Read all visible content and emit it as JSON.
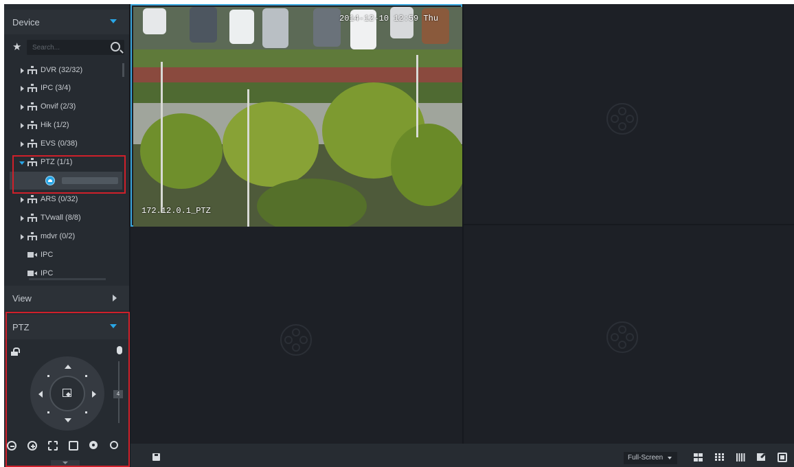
{
  "sidebar": {
    "device_header": {
      "title": "Device"
    },
    "search": {
      "placeholder": "Search..."
    },
    "tree": [
      {
        "label": "DVR (32/32)"
      },
      {
        "label": "IPC (3/4)"
      },
      {
        "label": "Onvif (2/3)"
      },
      {
        "label": "Hik (1/2)"
      },
      {
        "label": "EVS (0/38)"
      },
      {
        "label": "PTZ (1/1)"
      },
      {
        "label": ""
      },
      {
        "label": "ARS (0/32)"
      },
      {
        "label": "TVwall (8/8)"
      },
      {
        "label": "mdvr (0/2)"
      },
      {
        "label": "IPC"
      },
      {
        "label": "IPC"
      }
    ],
    "view_header": {
      "title": "View"
    },
    "ptz_header": {
      "title": "PTZ"
    },
    "ptz": {
      "speed": "4"
    }
  },
  "video": {
    "channel1": {
      "osd_time": "2014-12-10 12:59 Thu",
      "osd_name": "172.12.0.1_PTZ"
    }
  },
  "bottom_bar": {
    "fullscreen_label": "Full-Screen"
  },
  "colors": {
    "accent": "#29a6e6",
    "highlight_border": "#d0202a",
    "active_pane": "#3aa7dc"
  }
}
